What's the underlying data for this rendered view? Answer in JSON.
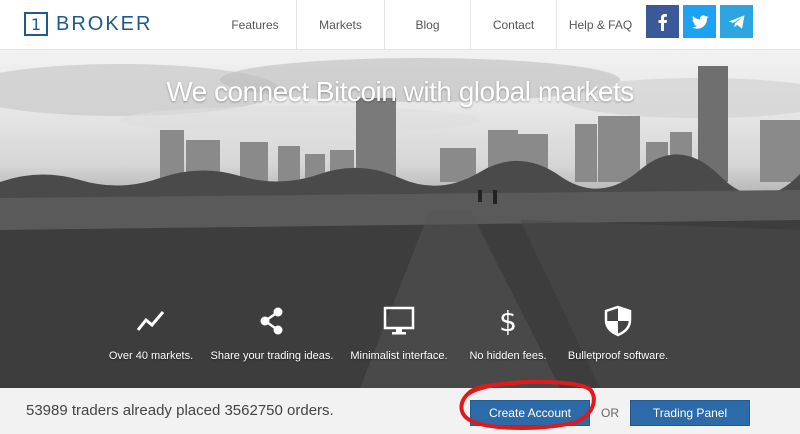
{
  "brand": {
    "logo_mark": "1",
    "logo_text": "BROKER",
    "color": "#1e5a8e"
  },
  "nav": {
    "items": [
      {
        "id": "features",
        "label": "Features"
      },
      {
        "id": "markets",
        "label": "Markets"
      },
      {
        "id": "blog",
        "label": "Blog"
      },
      {
        "id": "contact",
        "label": "Contact"
      },
      {
        "id": "help",
        "label": "Help & FAQ"
      }
    ]
  },
  "social": [
    {
      "name": "facebook-icon",
      "color": "#3b5998"
    },
    {
      "name": "twitter-icon",
      "color": "#1da1f2"
    },
    {
      "name": "telegram-icon",
      "color": "#2ca5e0"
    }
  ],
  "hero": {
    "headline": "We connect Bitcoin with global markets"
  },
  "features": [
    {
      "icon": "trend-line-icon",
      "label": "Over 40 markets."
    },
    {
      "icon": "share-icon",
      "label": "Share your trading ideas."
    },
    {
      "icon": "monitor-icon",
      "label": "Minimalist interface."
    },
    {
      "icon": "dollar-icon",
      "label": "No hidden fees."
    },
    {
      "icon": "shield-icon",
      "label": "Bulletproof software."
    }
  ],
  "footer": {
    "stats": "53989 traders already placed 3562750 orders.",
    "create_account": "Create Account",
    "or": "OR",
    "trading_panel": "Trading Panel",
    "accent": "#2c6aa8",
    "annotation_color": "#e0191b"
  }
}
